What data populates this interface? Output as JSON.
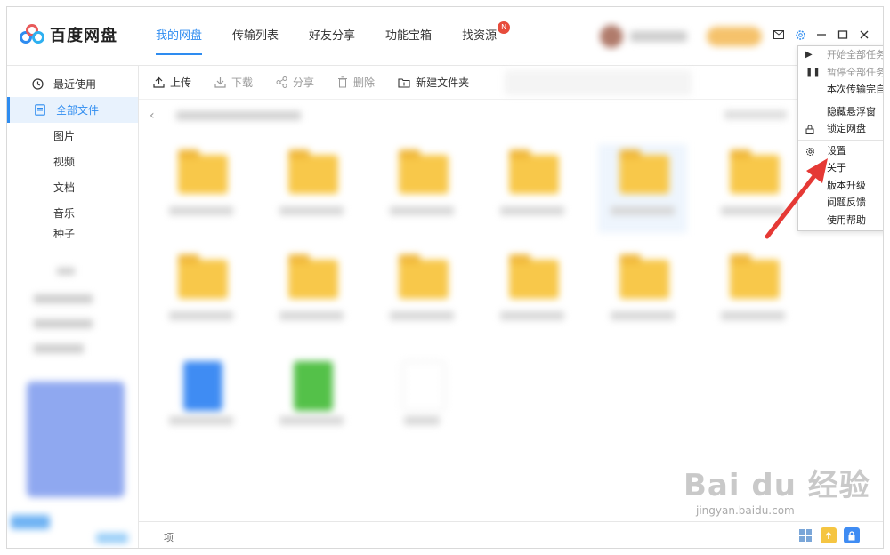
{
  "app": {
    "name": "百度网盘"
  },
  "nav_tabs": [
    {
      "label": "我的网盘",
      "active": true
    },
    {
      "label": "传输列表",
      "active": false
    },
    {
      "label": "好友分享",
      "active": false
    },
    {
      "label": "功能宝箱",
      "active": false
    },
    {
      "label": "找资源",
      "active": false,
      "badge": "N"
    }
  ],
  "toolbar": {
    "upload": "上传",
    "download": "下载",
    "share": "分享",
    "delete": "删除",
    "new_folder": "新建文件夹"
  },
  "sidebar": {
    "recent": "最近使用",
    "all_files": "全部文件",
    "items": [
      "图片",
      "视频",
      "文档",
      "音乐",
      "种子"
    ]
  },
  "menu": {
    "start_all": "开始全部任务",
    "pause_all": "暂停全部任务",
    "shutdown_after": "本次传输完自动关机",
    "hide_float": "隐藏悬浮窗",
    "lock": "锁定网盘",
    "settings": "设置",
    "about": "关于",
    "upgrade": "版本升级",
    "feedback": "问题反馈",
    "help": "使用帮助"
  },
  "status": {
    "text": "项"
  },
  "watermark": {
    "logo": "Bai du 经验",
    "url": "jingyan.baidu.com"
  },
  "colors": {
    "accent": "#2e8cf0",
    "folder": "#f8c84a",
    "arrow": "#e53935"
  }
}
